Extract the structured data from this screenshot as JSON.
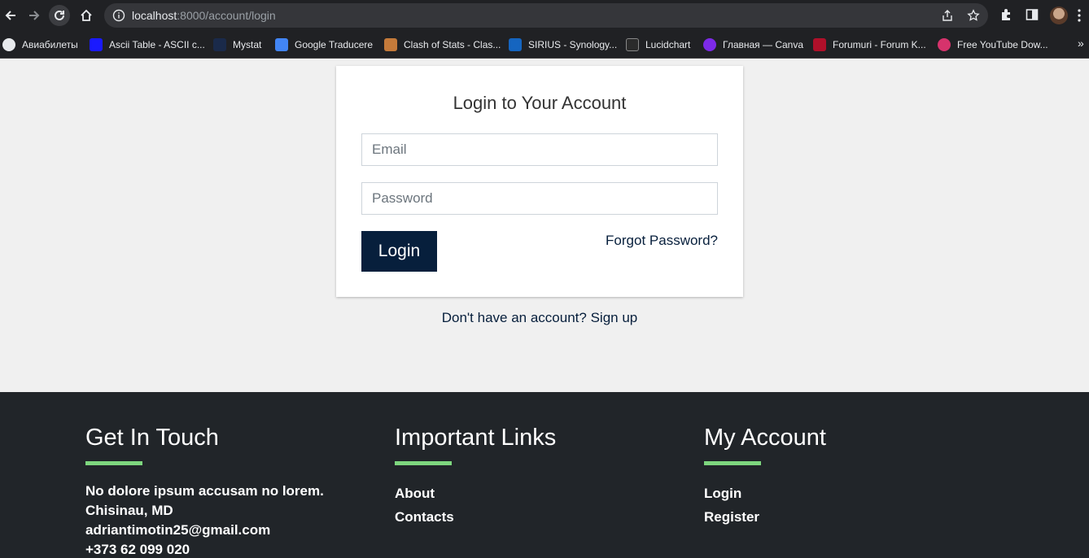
{
  "browser": {
    "url_host": "localhost",
    "url_path": ":8000/account/login",
    "bookmarks": [
      {
        "label": "Авиабилеты",
        "color": "#e8eaed"
      },
      {
        "label": "Ascii Table - ASCII c...",
        "color": "#1a1aff"
      },
      {
        "label": "Mystat",
        "color": "#1a2a4a"
      },
      {
        "label": "Google Traducere",
        "color": "#4285f4"
      },
      {
        "label": "Clash of Stats - Clas...",
        "color": "#c47a3a"
      },
      {
        "label": "SIRIUS - Synology...",
        "color": "#1565c0"
      },
      {
        "label": "Lucidchart",
        "color": "#2b2b2b"
      },
      {
        "label": "Главная — Canva",
        "color": "#7d2ae8"
      },
      {
        "label": "Forumuri - Forum K...",
        "color": "#b0102a"
      },
      {
        "label": "Free YouTube Dow...",
        "color": "#d6336c"
      }
    ],
    "more_label": "»"
  },
  "login": {
    "title": "Login to Your Account",
    "email_placeholder": "Email",
    "password_placeholder": "Password",
    "login_button": "Login",
    "forgot_link": "Forgot Password?",
    "no_account_text": "Don't have an account?",
    "signup_link": "Sign up"
  },
  "footer": {
    "contact": {
      "heading": "Get In Touch",
      "lines": [
        "No dolore ipsum accusam no lorem.",
        "Chisinau, MD",
        "adriantimotin25@gmail.com",
        "+373 62 099 020"
      ]
    },
    "important": {
      "heading": "Important Links",
      "links": [
        "About",
        "Contacts"
      ]
    },
    "account": {
      "heading": "My Account",
      "links": [
        "Login",
        "Register"
      ]
    }
  },
  "colors": {
    "navy": "#071f3c",
    "footer_bg": "#212529",
    "accent_green": "#7ed67e",
    "page_bg": "#f0f0f0"
  }
}
